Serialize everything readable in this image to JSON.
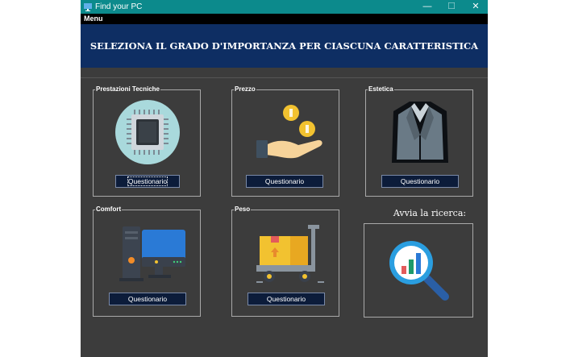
{
  "window": {
    "title": "Find your PC",
    "controls": {
      "minimize": "—",
      "maximize": "☐",
      "close": "✕"
    }
  },
  "menubar": {
    "menu_label": "Menu"
  },
  "banner": {
    "heading": "SELEZIONA IL GRADO D'IMPORTANZA PER CIASCUNA CARATTERISTICA"
  },
  "panels": [
    {
      "title": "Prestazioni Tecniche",
      "button": "Questionario",
      "icon": "cpu-chip-icon"
    },
    {
      "title": "Prezzo",
      "button": "Questionario",
      "icon": "coins-hand-icon"
    },
    {
      "title": "Estetica",
      "button": "Questionario",
      "icon": "suit-jacket-icon"
    },
    {
      "title": "Comfort",
      "button": "Questionario",
      "icon": "desktop-computer-icon"
    },
    {
      "title": "Peso",
      "button": "Questionario",
      "icon": "cart-boxes-icon"
    }
  ],
  "search": {
    "title": "Avvia la ricerca:",
    "icon": "magnifier-chart-icon"
  },
  "colors": {
    "titlebar": "#0c8a8c",
    "banner": "#0e2e63",
    "window_bg": "#3c3c3c",
    "button_bg": "#0c1c3a"
  }
}
